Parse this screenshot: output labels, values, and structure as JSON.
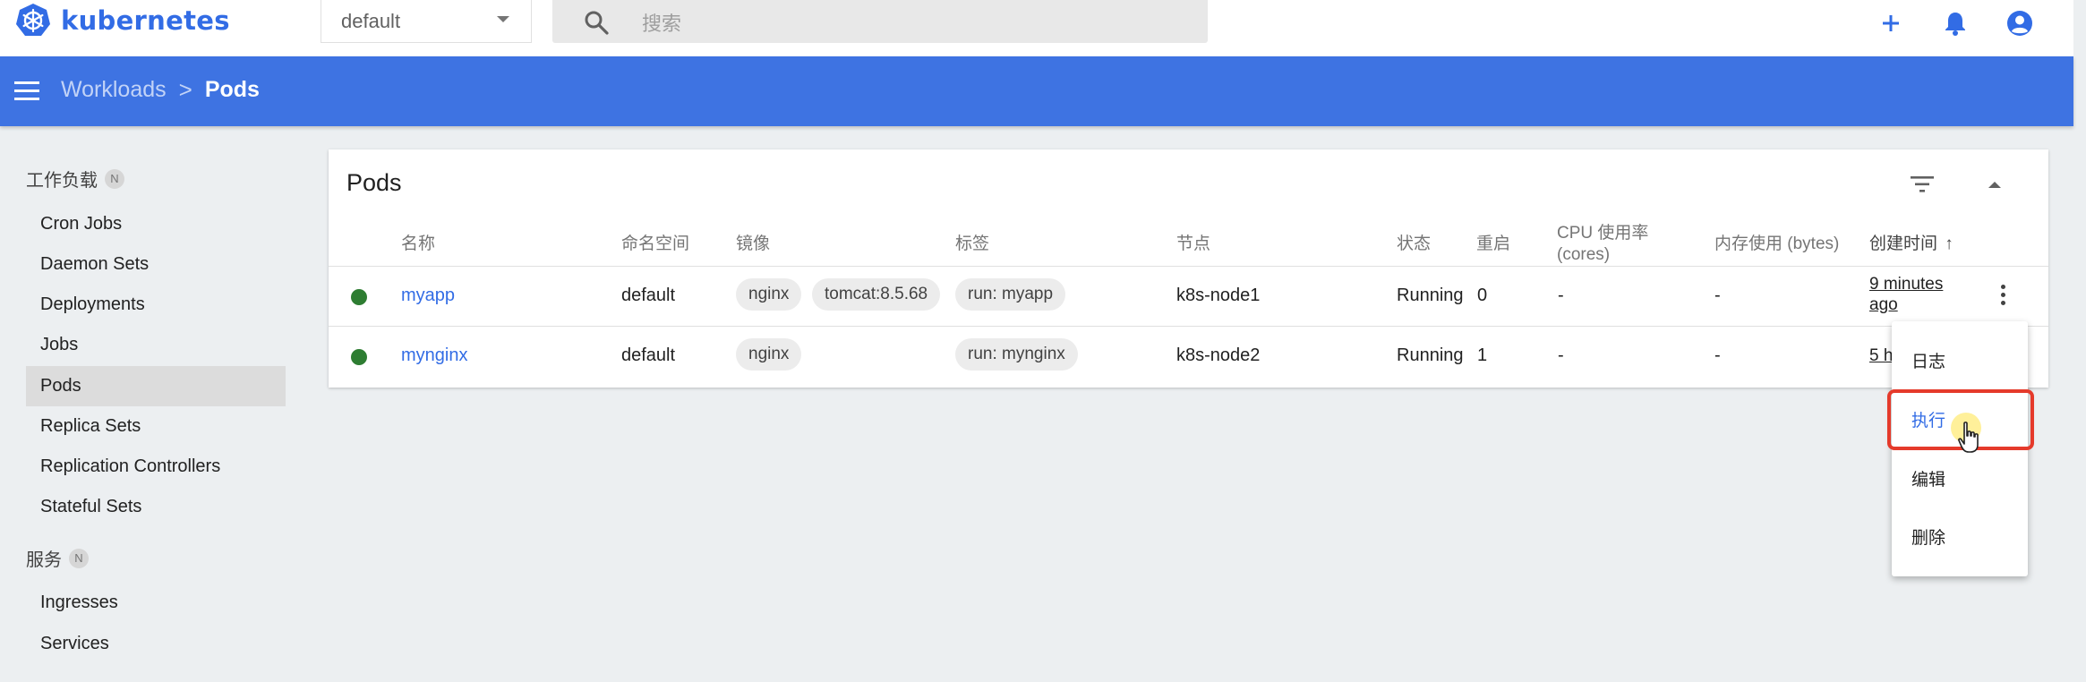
{
  "header": {
    "brand": "kubernetes",
    "namespace": "default",
    "search_placeholder": "搜索",
    "actions": [
      "add-icon",
      "notifications-icon",
      "account-icon"
    ]
  },
  "breadcrumb": {
    "parent": "Workloads",
    "separator": ">",
    "current": "Pods"
  },
  "sidebar": {
    "sections": [
      {
        "label": "工作负载",
        "badge": "N",
        "items": [
          "Cron Jobs",
          "Daemon Sets",
          "Deployments",
          "Jobs",
          "Pods",
          "Replica Sets",
          "Replication Controllers",
          "Stateful Sets"
        ]
      },
      {
        "label": "服务",
        "badge": "N",
        "items": [
          "Ingresses",
          "Services"
        ]
      }
    ],
    "active_item": "Pods"
  },
  "pods_card": {
    "title": "Pods",
    "columns": {
      "name": "名称",
      "namespace": "命名空间",
      "images": "镜像",
      "labels": "标签",
      "node": "节点",
      "status": "状态",
      "restarts": "重启",
      "cpu_line1": "CPU 使用率",
      "cpu_line2": "(cores)",
      "memory": "内存使用 (bytes)",
      "created": "创建时间",
      "created_sort": "↑"
    },
    "rows": [
      {
        "name": "myapp",
        "namespace": "default",
        "images": [
          "nginx",
          "tomcat:8.5.68"
        ],
        "labels": [
          "run: myapp"
        ],
        "node": "k8s-node1",
        "status": "Running",
        "restarts": "0",
        "cpu": "-",
        "memory": "-",
        "created_line1": "9 minutes",
        "created_line2": "ago",
        "status_color": "#2e7d32"
      },
      {
        "name": "mynginx",
        "namespace": "default",
        "images": [
          "nginx"
        ],
        "labels": [
          "run: mynginx"
        ],
        "node": "k8s-node2",
        "status": "Running",
        "restarts": "1",
        "cpu": "-",
        "memory": "-",
        "created_line1": "5 h",
        "status_color": "#2e7d32"
      }
    ]
  },
  "context_menu": {
    "items": [
      "日志",
      "执行",
      "编辑",
      "删除"
    ],
    "highlighted": "执行"
  },
  "colors": {
    "brand": "#326ce5",
    "toolbar": "#3e73e2",
    "running": "#2e7d32",
    "highlight_outline": "#e53a2b"
  }
}
